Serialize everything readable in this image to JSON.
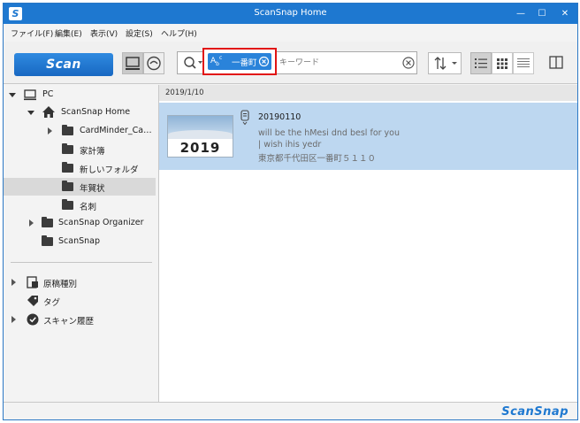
{
  "window": {
    "title": "ScanSnap Home",
    "app_icon": "S",
    "minimize": "—",
    "maximize": "☐",
    "close": "✕"
  },
  "menu": [
    "ファイル(F)",
    "編集(E)",
    "表示(V)",
    "設定(S)",
    "ヘルプ(H)"
  ],
  "toolbar": {
    "scan_label": "Scan",
    "search_tag_prefix": "A",
    "search_tag_sub": "b",
    "search_tag_c": "c",
    "search_tag_text": "一番町",
    "keyword_placeholder": "キーワード"
  },
  "tree": {
    "pc": "PC",
    "scansnap_home": "ScanSnap Home",
    "folders": [
      "CardMinder_Ca…",
      "家計簿",
      "新しいフォルダ",
      "年賀状",
      "名刺"
    ],
    "selected_folder": "年賀状",
    "organizer": "ScanSnap Organizer",
    "scansnap": "ScanSnap",
    "doc_type": "原稿種別",
    "tag": "タグ",
    "history": "スキャン履歴"
  },
  "content": {
    "date_header": "2019/1/10",
    "doc": {
      "title": "20190110",
      "thumb_year": "2019",
      "line1": "will be the hMesi dnd besl for you",
      "line2": "| wish ihis yedr",
      "line3": "東京都千代田区一番町５１１０"
    }
  },
  "statusbar": {
    "brand": "ScanSnap"
  },
  "colors": {
    "accent": "#1e78d0",
    "selection": "#bdd7f0",
    "search_highlight": "#e11414"
  }
}
